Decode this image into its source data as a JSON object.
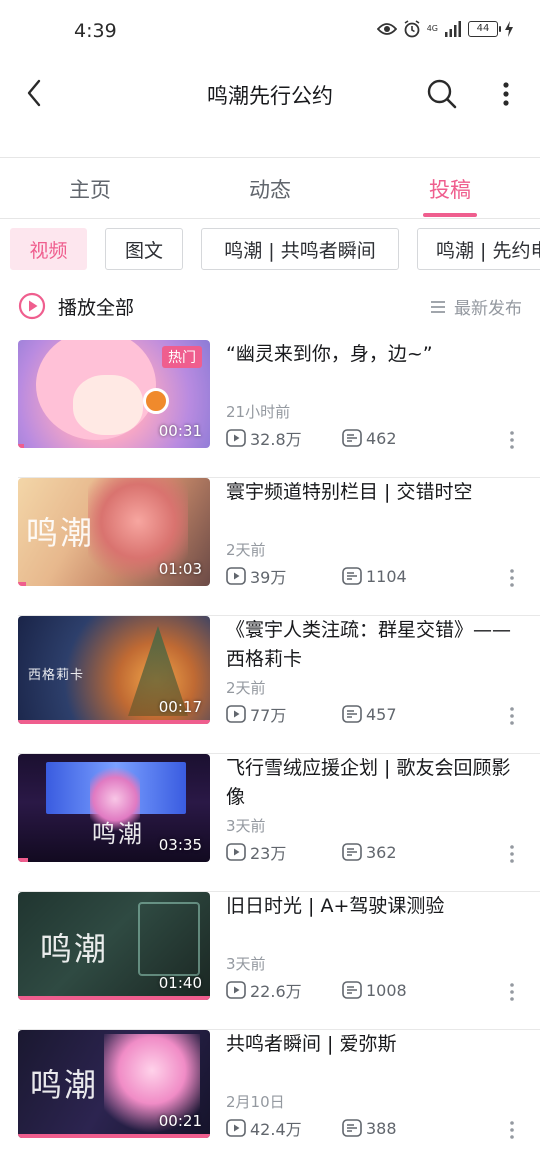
{
  "status": {
    "time": "4:39",
    "network": "4G",
    "battery": "44"
  },
  "header": {
    "title": "鸣潮先行公约"
  },
  "tabs": [
    {
      "label": "主页",
      "active": false
    },
    {
      "label": "动态",
      "active": false
    },
    {
      "label": "投稿",
      "active": true
    }
  ],
  "filters": [
    {
      "label": "视频",
      "active": true
    },
    {
      "label": "图文",
      "active": false
    },
    {
      "label": "鸣潮 | 共鸣者瞬间",
      "active": false
    },
    {
      "label": "鸣潮 | 先约电台",
      "active": false
    }
  ],
  "controls": {
    "play_all": "播放全部",
    "sort": "最新发布"
  },
  "videos": [
    {
      "title": "“幽灵来到你，身，边~”",
      "time": "21小时前",
      "views": "32.8万",
      "danmaku": "462",
      "duration": "00:31",
      "badge": "热门"
    },
    {
      "title": "寰宇频道特别栏目 | 交错时空",
      "time": "2天前",
      "views": "39万",
      "danmaku": "1104",
      "duration": "01:03",
      "thumb_text": "鸣潮"
    },
    {
      "title": "《寰宇人类注疏：群星交错》——西格莉卡",
      "time": "2天前",
      "views": "77万",
      "danmaku": "457",
      "duration": "00:17",
      "thumb_text": "西格莉卡"
    },
    {
      "title": "飞行雪绒应援企划 | 歌友会回顾影像",
      "time": "3天前",
      "views": "23万",
      "danmaku": "362",
      "duration": "03:35",
      "thumb_text": "鸣潮"
    },
    {
      "title": "旧日时光 | A+驾驶课测验",
      "time": "3天前",
      "views": "22.6万",
      "danmaku": "1008",
      "duration": "01:40",
      "thumb_text": "鸣潮"
    },
    {
      "title": "共鸣者瞬间 | 爱弥斯",
      "time": "2月10日",
      "views": "42.4万",
      "danmaku": "388",
      "duration": "00:21",
      "thumb_text": "鸣潮"
    }
  ],
  "colors": {
    "accent": "#ef5e8e",
    "text_primary": "#18191c",
    "text_secondary": "#9499a0",
    "divider": "#e6e6e6"
  },
  "icons": {
    "back": "chevron-left-icon",
    "search": "search-icon",
    "more": "more-vertical-icon",
    "play_all": "play-circle-icon",
    "sort": "list-sort-icon",
    "views": "play-box-icon",
    "danmaku": "danmaku-icon",
    "status": [
      "eye-icon",
      "alarm-icon",
      "signal-icon",
      "battery-icon",
      "charging-icon"
    ]
  }
}
